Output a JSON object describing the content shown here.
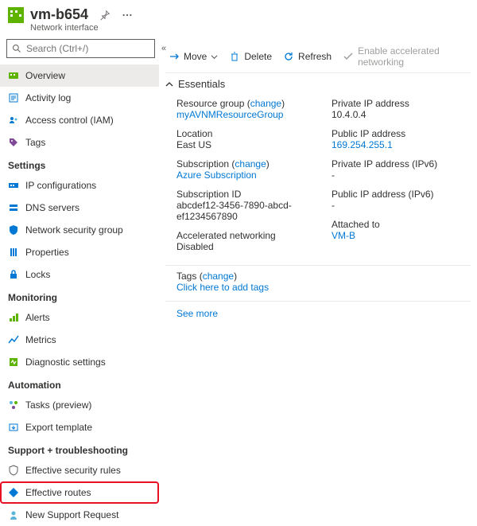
{
  "header": {
    "title": "vm-b654",
    "subtitle": "Network interface"
  },
  "search": {
    "placeholder": "Search (Ctrl+/)"
  },
  "nav": {
    "overview": "Overview",
    "activity": "Activity log",
    "iam": "Access control (IAM)",
    "tags": "Tags",
    "sec_settings": "Settings",
    "ipconfig": "IP configurations",
    "dns": "DNS servers",
    "nsg": "Network security group",
    "props": "Properties",
    "locks": "Locks",
    "sec_monitor": "Monitoring",
    "alerts": "Alerts",
    "metrics": "Metrics",
    "diag": "Diagnostic settings",
    "sec_auto": "Automation",
    "tasks": "Tasks (preview)",
    "export": "Export template",
    "sec_support": "Support + troubleshooting",
    "effsec": "Effective security rules",
    "effroutes": "Effective routes",
    "support": "New Support Request"
  },
  "cmd": {
    "move": "Move",
    "delete": "Delete",
    "refresh": "Refresh",
    "accel": "Enable accelerated networking"
  },
  "ess": {
    "title": "Essentials",
    "rg_label": "Resource group",
    "change": "change",
    "rg_value": "myAVNMResourceGroup",
    "loc_label": "Location",
    "loc_value": "East US",
    "sub_label": "Subscription",
    "sub_value": "Azure Subscription",
    "subid_label": "Subscription ID",
    "subid_value": "abcdef12-3456-7890-abcd-ef1234567890",
    "an_label": "Accelerated networking",
    "an_value": "Disabled",
    "pip_label": "Private IP address",
    "pip_value": "10.4.0.4",
    "pubip_label": "Public IP address",
    "pubip_value": "169.254.255.1",
    "pip6_label": "Private IP address (IPv6)",
    "pip6_value": "-",
    "pubip6_label": "Public IP address (IPv6)",
    "pubip6_value": "-",
    "att_label": "Attached to",
    "att_value": "VM-B",
    "tags_label": "Tags",
    "tags_value": "Click here to add tags",
    "seemore": "See more"
  }
}
